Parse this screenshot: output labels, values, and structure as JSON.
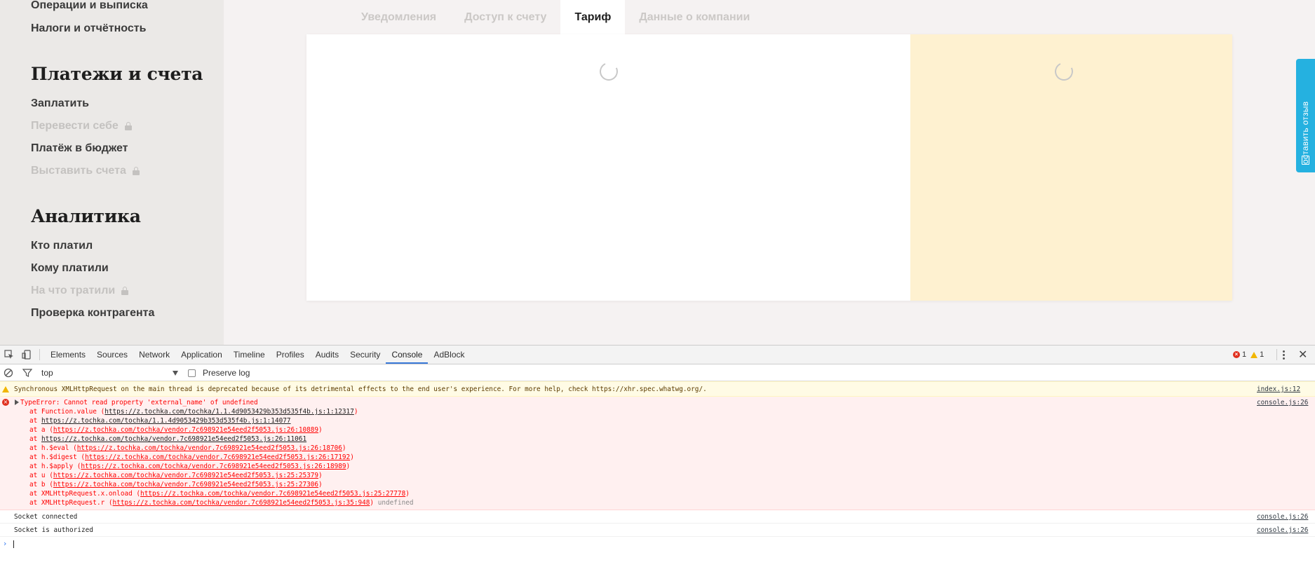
{
  "sidebar": {
    "links_top": [
      {
        "label": "Операции и выписка"
      },
      {
        "label": "Налоги и отчётность"
      }
    ],
    "payments_heading": "Платежи и счета",
    "payments_links": [
      {
        "label": "Заплатить",
        "locked": false
      },
      {
        "label": "Перевести себе",
        "locked": true
      },
      {
        "label": "Платёж в бюджет",
        "locked": false
      },
      {
        "label": "Выставить счета",
        "locked": true
      }
    ],
    "analytics_heading": "Аналитика",
    "analytics_links": [
      {
        "label": "Кто платил",
        "locked": false
      },
      {
        "label": "Кому платили",
        "locked": false
      },
      {
        "label": "На что тратили",
        "locked": true
      },
      {
        "label": "Проверка контрагента",
        "locked": false
      }
    ]
  },
  "tabs": [
    {
      "label": "Уведомления",
      "active": false
    },
    {
      "label": "Доступ к счету",
      "active": false
    },
    {
      "label": "Тариф",
      "active": true
    },
    {
      "label": "Данные о компании",
      "active": false
    }
  ],
  "feedback": {
    "label": "оставить отзыв"
  },
  "colors": {
    "accent": "#25b1e0",
    "card_right_bg": "#fef1d0",
    "sidebar_bg": "#ebe9e7",
    "devtools_active": "#3879d9"
  },
  "devtools": {
    "tabs": [
      {
        "label": "Elements"
      },
      {
        "label": "Sources"
      },
      {
        "label": "Network"
      },
      {
        "label": "Application"
      },
      {
        "label": "Timeline"
      },
      {
        "label": "Profiles"
      },
      {
        "label": "Audits"
      },
      {
        "label": "Security"
      },
      {
        "label": "Console",
        "active": true
      },
      {
        "label": "AdBlock"
      }
    ],
    "error_count": "1",
    "warning_count": "1",
    "context": "top",
    "preserve_log": "Preserve log",
    "warning": {
      "text": "Synchronous XMLHttpRequest on the main thread is deprecated because of its detrimental effects to the end user's experience. For more help, check https://xhr.spec.whatwg.org/.",
      "source": "index.js:12"
    },
    "error": {
      "text": "TypeError: Cannot read property 'external_name' of undefined",
      "source": "console.js:26",
      "stack": [
        {
          "prefix": "at Function.value (",
          "url": "https://z.tochka.com/tochka/1.1.4d9053429b353d535f4b.js:1:12317",
          "suffix": ")",
          "dark": true
        },
        {
          "prefix": "at ",
          "url": "https://z.tochka.com/tochka/1.1.4d9053429b353d535f4b.js:1:14077",
          "suffix": "",
          "dark": true
        },
        {
          "prefix": "at a (",
          "url": "https://z.tochka.com/tochka/vendor.7c698921e54eed2f5053.js:26:10889",
          "suffix": ")",
          "dark": false
        },
        {
          "prefix": "at ",
          "url": "https://z.tochka.com/tochka/vendor.7c698921e54eed2f5053.js:26:11061",
          "suffix": "",
          "dark": true
        },
        {
          "prefix": "at h.$eval (",
          "url": "https://z.tochka.com/tochka/vendor.7c698921e54eed2f5053.js:26:18706",
          "suffix": ")",
          "dark": false
        },
        {
          "prefix": "at h.$digest (",
          "url": "https://z.tochka.com/tochka/vendor.7c698921e54eed2f5053.js:26:17192",
          "suffix": ")",
          "dark": false
        },
        {
          "prefix": "at h.$apply (",
          "url": "https://z.tochka.com/tochka/vendor.7c698921e54eed2f5053.js:26:18989",
          "suffix": ")",
          "dark": false
        },
        {
          "prefix": "at u (",
          "url": "https://z.tochka.com/tochka/vendor.7c698921e54eed2f5053.js:25:25379",
          "suffix": ")",
          "dark": false
        },
        {
          "prefix": "at b (",
          "url": "https://z.tochka.com/tochka/vendor.7c698921e54eed2f5053.js:25:27306",
          "suffix": ")",
          "dark": false
        },
        {
          "prefix": "at XMLHttpRequest.x.onload (",
          "url": "https://z.tochka.com/tochka/vendor.7c698921e54eed2f5053.js:25:27778",
          "suffix": ")",
          "dark": false
        },
        {
          "prefix": "at XMLHttpRequest.r (",
          "url": "https://z.tochka.com/tochka/vendor.7c698921e54eed2f5053.js:35:948",
          "suffix": ")",
          "dark": false,
          "tail": "undefined"
        }
      ]
    },
    "logs": [
      {
        "text": "Socket connected",
        "source": "console.js:26"
      },
      {
        "text": "Socket is authorized",
        "source": "console.js:26"
      }
    ]
  }
}
